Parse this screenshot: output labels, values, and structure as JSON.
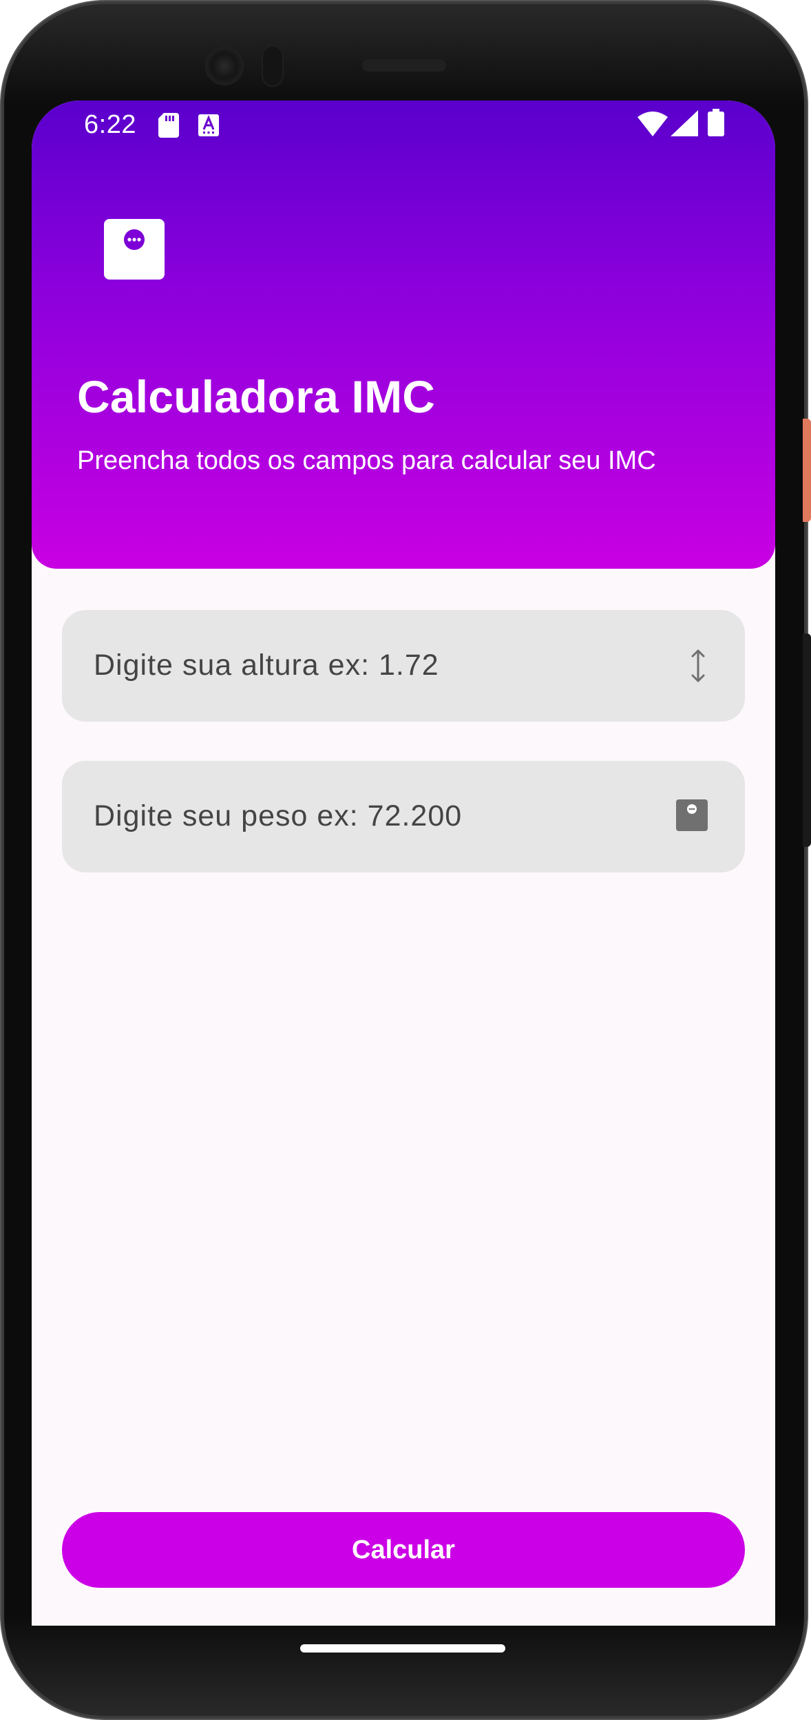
{
  "status_bar": {
    "time": "6:22",
    "icons": [
      "sd-card-icon",
      "accessibility-a-icon",
      "wifi-icon",
      "cellular-signal-icon",
      "battery-icon"
    ]
  },
  "header": {
    "app_icon": "chat-bubble-icon",
    "title": "Calculadora IMC",
    "subtitle": "Preencha todos os campos para calcular seu IMC"
  },
  "form": {
    "height_field": {
      "placeholder": "Digite sua altura ex: 1.72",
      "value": "",
      "icon": "vertical-arrows-icon"
    },
    "weight_field": {
      "placeholder": "Digite seu peso ex: 72.200",
      "value": "",
      "icon": "scale-icon"
    }
  },
  "actions": {
    "calculate_label": "Calcular"
  },
  "colors": {
    "header_gradient_top": "#5a00cc",
    "header_gradient_bottom": "#c800e2",
    "button": "#cc00e6",
    "field_background": "#e6e6e6",
    "screen_background": "#fdf8fc"
  }
}
